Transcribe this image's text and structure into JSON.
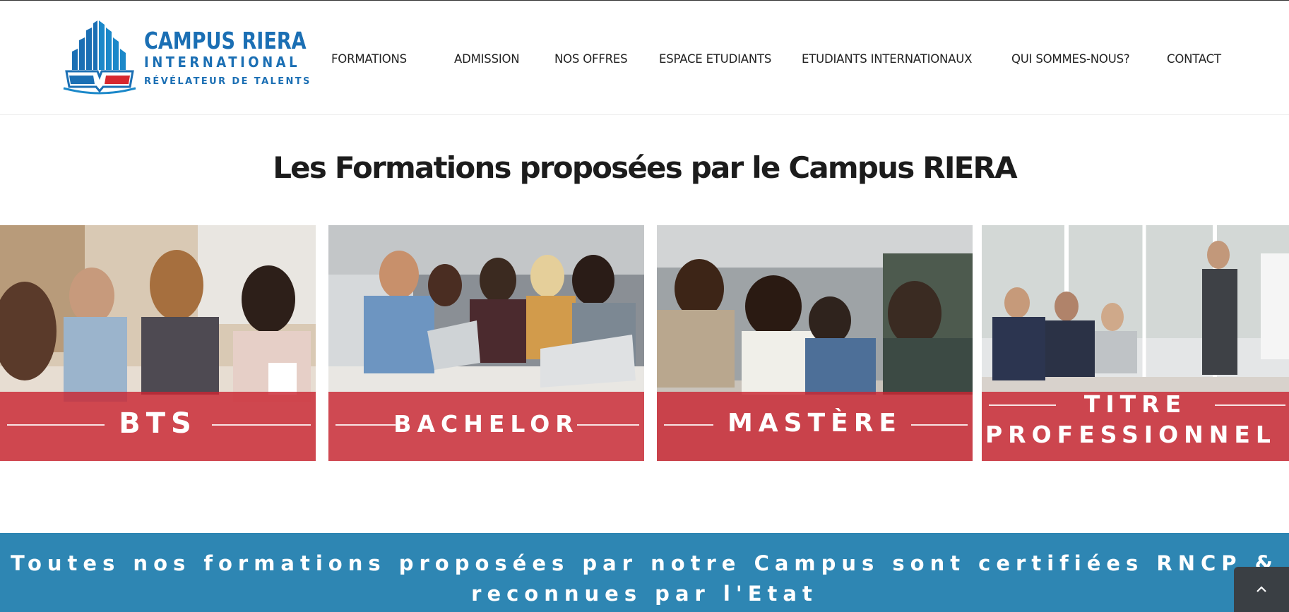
{
  "logo": {
    "line1": "CAMPUS RIERA",
    "line2": "INTERNATIONAL",
    "line3": "RÉVÉLATEUR DE TALENTS",
    "icon": "campus-building-logo-icon",
    "colors": {
      "blue": "#1b6fb4",
      "red": "#d7272f"
    }
  },
  "nav": {
    "items": [
      {
        "label": "FORMATIONS"
      },
      {
        "label": "ADMISSION"
      },
      {
        "label": "NOS OFFRES"
      },
      {
        "label": "ESPACE ETUDIANTS"
      },
      {
        "label": "ETUDIANTS INTERNATIONAUX"
      },
      {
        "label": "QUI SOMMES-NOUS?"
      },
      {
        "label": "CONTACT"
      }
    ]
  },
  "main": {
    "title": "Les Formations proposées par le Campus RIERA",
    "cards": [
      {
        "label": "BTS",
        "image": "students-group-photo"
      },
      {
        "label": "BACHELOR",
        "image": "students-laptops-photo"
      },
      {
        "label": "MASTÈRE",
        "image": "students-reading-photo"
      },
      {
        "label_line1": "TITRE",
        "label_line2": "PROFESSIONNEL",
        "image": "business-meeting-photo"
      }
    ],
    "band_color": "#c92632"
  },
  "banner": {
    "line1": "Toutes nos formations proposées par notre Campus sont certifiées RNCP &",
    "line2": "reconnues par l'Etat",
    "background": "#2e86b3"
  },
  "scroll_top": {
    "icon": "chevron-up-icon"
  }
}
